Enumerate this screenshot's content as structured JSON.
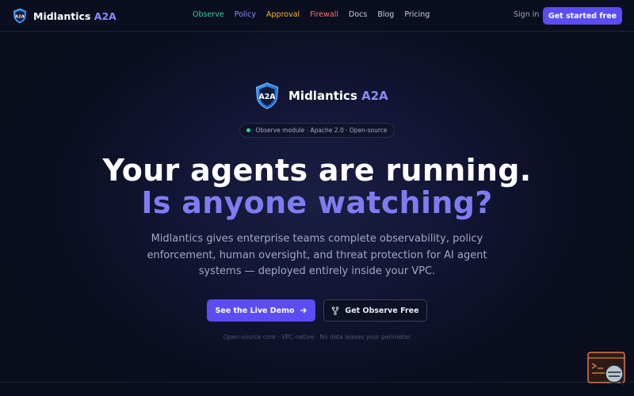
{
  "brand": {
    "name_main": "Midlantics",
    "name_accent": "A2A",
    "logo_text": "A2A"
  },
  "nav": {
    "links": [
      {
        "label": "Observe",
        "color": "#34d399"
      },
      {
        "label": "Policy",
        "color": "#8b8bff"
      },
      {
        "label": "Approval",
        "color": "#f5b62a"
      },
      {
        "label": "Firewall",
        "color": "#f87171"
      },
      {
        "label": "Docs",
        "color": "#c9cde0"
      },
      {
        "label": "Blog",
        "color": "#c9cde0"
      },
      {
        "label": "Pricing",
        "color": "#c9cde0"
      }
    ],
    "signin": "Sign in",
    "cta": "Get started free"
  },
  "hero": {
    "pill": "Observe module · Apache 2.0 · Open-source",
    "headline_line1": "Your agents are running.",
    "headline_line2": "Is anyone watching?",
    "subtext": "Midlantics gives enterprise teams complete observability, policy enforcement, human oversight, and threat protection for AI agent systems — deployed entirely inside your VPC.",
    "primary_button": "See the Live Demo",
    "secondary_button": "Get Observe Free",
    "footnote": "Open-source core · VPC-native · No data leaves your perimeter"
  },
  "colors": {
    "accent": "#5b4cf5",
    "accent_text": "#7f7cf2",
    "status_dot": "#34d399"
  },
  "icons": [
    "shield-logo-icon",
    "arrow-right-icon",
    "git-fork-icon",
    "chat-support-widget-icon"
  ]
}
